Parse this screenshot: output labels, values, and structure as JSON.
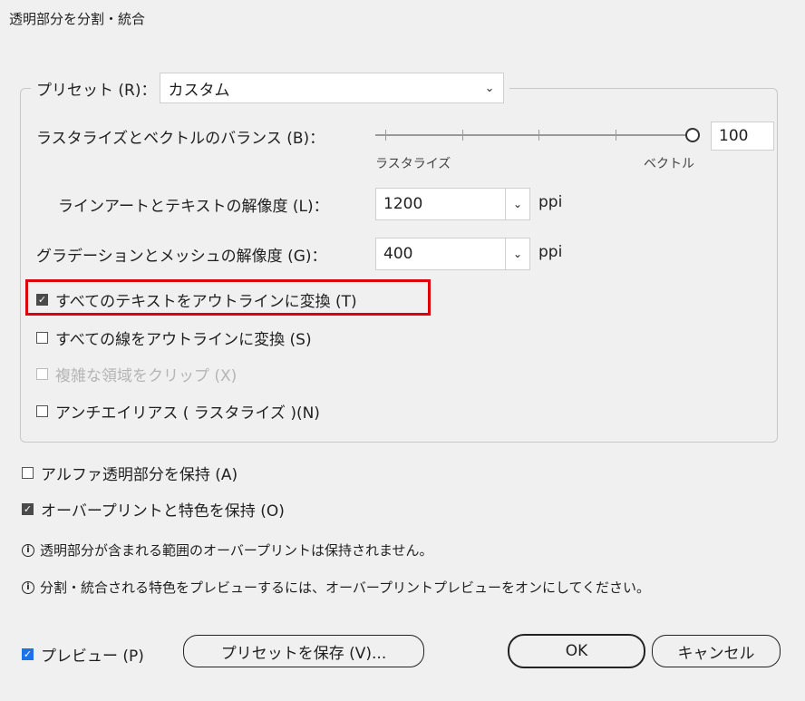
{
  "window": {
    "title": "透明部分を分割・統合"
  },
  "preset": {
    "label": "プリセット (R)：",
    "value": "カスタム"
  },
  "balance": {
    "label": "ラスタライズとベクトルのバランス (B)：",
    "value": "100",
    "left_label": "ラスタライズ",
    "right_label": "ベクトル",
    "level_percent": 100
  },
  "lineart": {
    "label": "ラインアートとテキストの解像度 (L)：",
    "value": "1200",
    "unit": "ppi"
  },
  "gradient": {
    "label": "グラデーションとメッシュの解像度 (G)：",
    "value": "400",
    "unit": "ppi"
  },
  "checkboxes": [
    {
      "label": "すべてのテキストをアウトラインに変換 (T)",
      "checked": true,
      "disabled": false
    },
    {
      "label": "すべての線をアウトラインに変換 (S)",
      "checked": false,
      "disabled": false
    },
    {
      "label": "複雑な領域をクリップ (X)",
      "checked": false,
      "disabled": true
    },
    {
      "label": "アンチエイリアス ( ラスタライズ )(N)",
      "checked": false,
      "disabled": false
    }
  ],
  "alpha": {
    "label": "アルファ透明部分を保持 (A)",
    "checked": false
  },
  "overprint": {
    "label": "オーバープリントと特色を保持 (O)",
    "checked": true
  },
  "info": [
    "透明部分が含まれる範囲のオーバープリントは保持されません。",
    "分割・統合される特色をプレビューするには、オーバープリントプレビューをオンにしてください。"
  ],
  "footer": {
    "preview_label": "プレビュー (P)",
    "preview_checked": true,
    "save_preset": "プリセットを保存 (V)...",
    "ok": "OK",
    "cancel": "キャンセル"
  },
  "colors": {
    "highlight": "#e0000b",
    "preview_check": "#1a73e8"
  }
}
